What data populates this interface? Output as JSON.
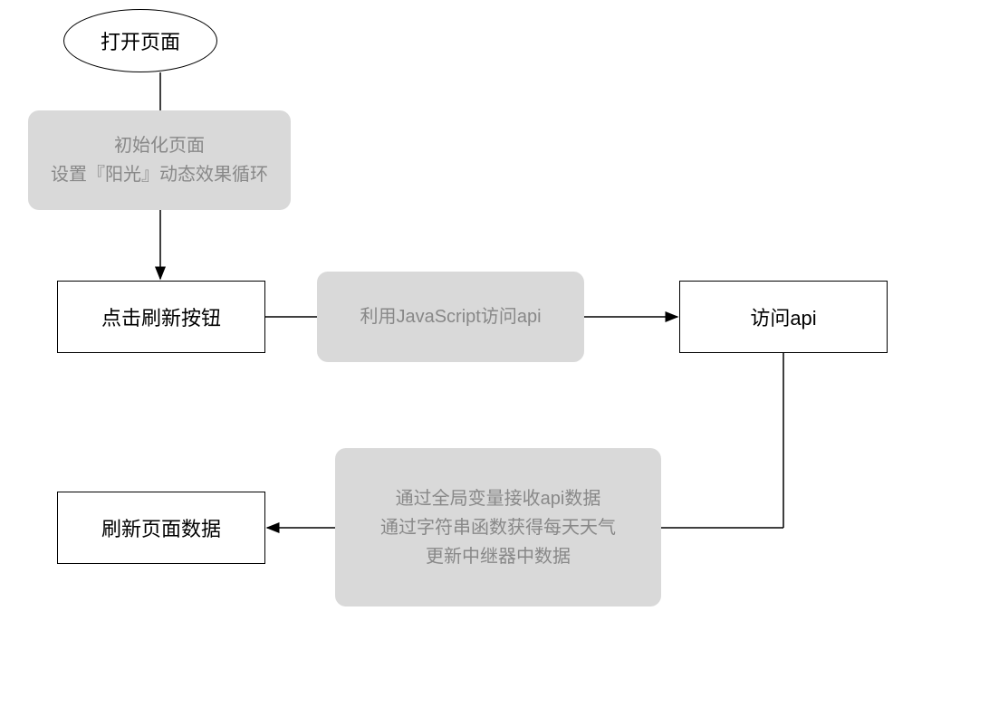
{
  "nodes": {
    "start": "打开页面",
    "click_refresh": "点击刷新按钮",
    "access_api": "访问api",
    "refresh_data": "刷新页面数据"
  },
  "notes": {
    "init": {
      "line1": "初始化页面",
      "line2": "设置『阳光』动态效果循环"
    },
    "js_access": "利用JavaScript访问api",
    "receive": {
      "line1": "通过全局变量接收api数据",
      "line2": "通过字符串函数获得每天天气",
      "line3": "更新中继器中数据"
    }
  }
}
